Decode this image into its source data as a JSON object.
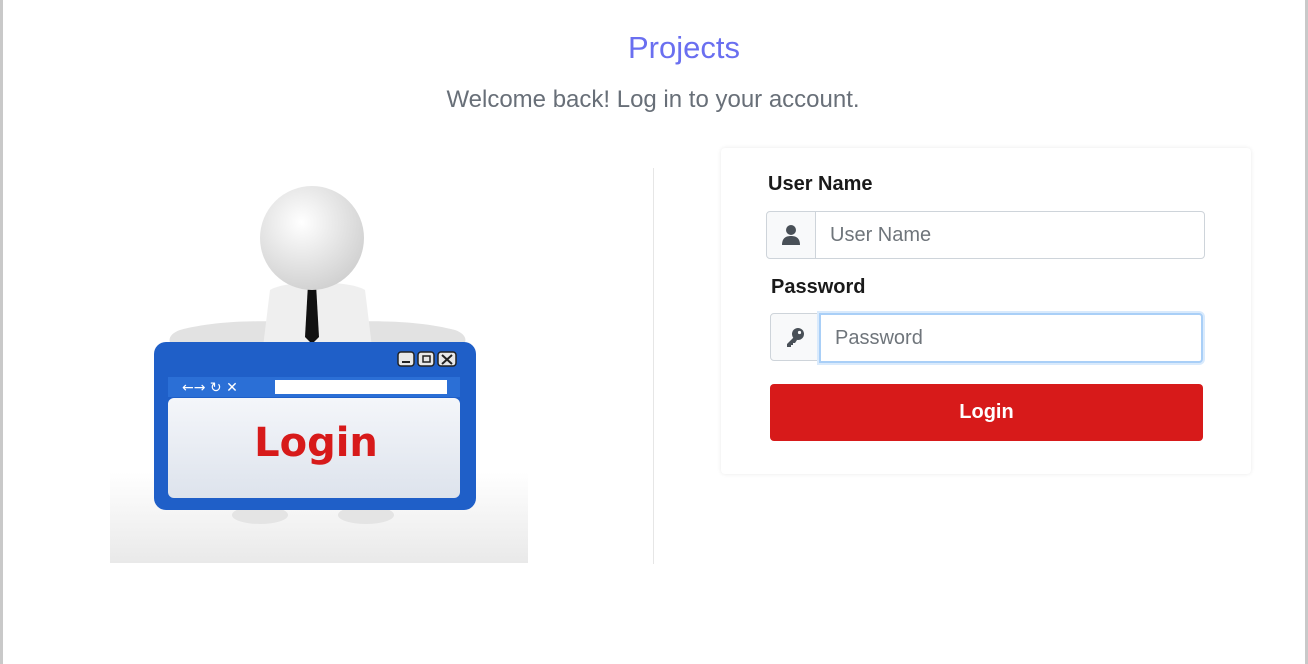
{
  "header": {
    "title": "Projects",
    "subtitle": "Welcome back! Log in to your account."
  },
  "illustration": {
    "window_text": "Login",
    "nav_glyphs": "←→ ↻ ✕"
  },
  "form": {
    "username_label": "User Name",
    "username_placeholder": "User Name",
    "username_icon": "user-icon",
    "password_label": "Password",
    "password_placeholder": "Password",
    "password_icon": "key-icon",
    "submit_label": "Login"
  },
  "colors": {
    "title": "#6a6ff0",
    "button": "#d71a1a",
    "window_blue": "#1f5fc8",
    "login_text": "#d71a1a"
  }
}
